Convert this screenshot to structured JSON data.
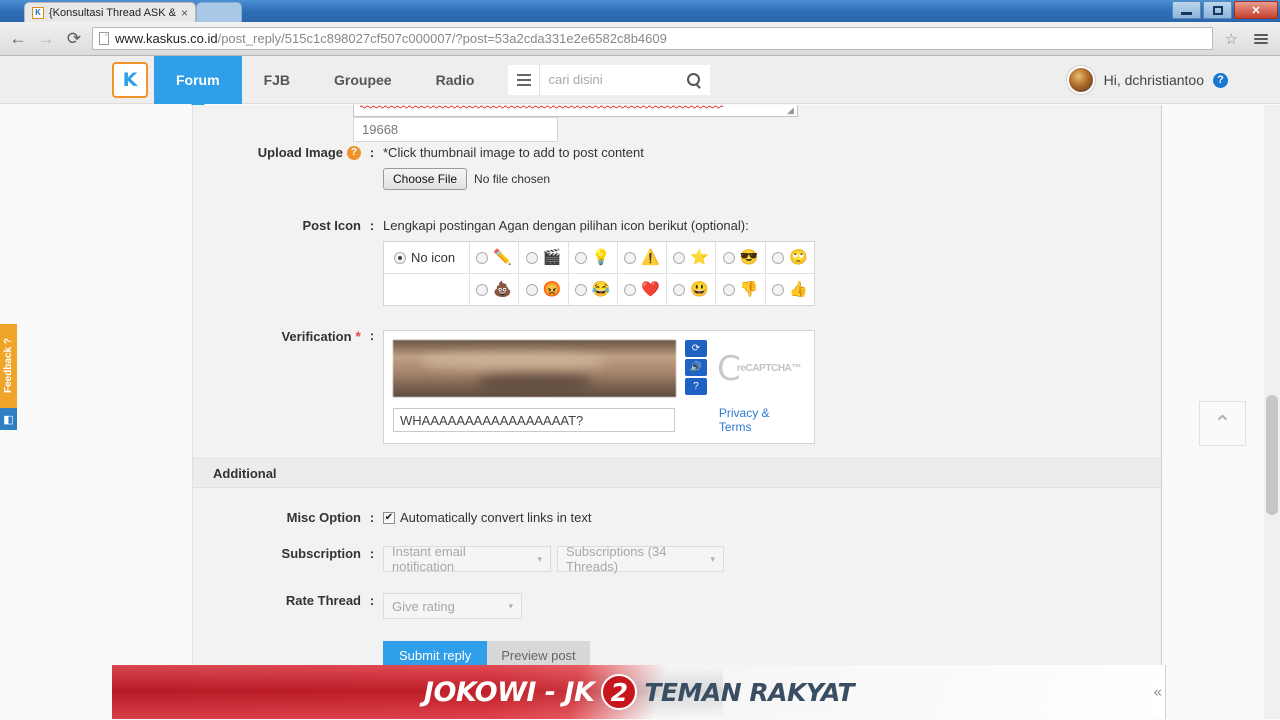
{
  "browser": {
    "tab": {
      "title": "{Konsultasi Thread ASK &",
      "favicon_icon": "kaskus-favicon",
      "close_icon": "close-icon"
    },
    "new_tab_icon": "new-tab-icon",
    "window_controls": {
      "minimize": "minimize-icon",
      "restore": "restore-icon",
      "close": "✕"
    },
    "back_icon": "←",
    "forward_icon": "→",
    "reload_icon": "⟳",
    "url_domain": "www.kaskus.co.id",
    "url_path": "/post_reply/515c1c898027cf507c000007/?post=53a2cda331e2e6582c8b4609",
    "page_icon": "page-icon",
    "bookmark_icon": "☆",
    "menu_icon": "hamburger-menu-icon"
  },
  "site_header": {
    "logo": "K",
    "nav": [
      {
        "label": "Forum",
        "active": true
      },
      {
        "label": "FJB",
        "active": false
      },
      {
        "label": "Groupee",
        "active": false
      },
      {
        "label": "Radio",
        "active": false
      }
    ],
    "search_placeholder": "cari disini",
    "search_icon": "search-icon",
    "menu_icon": "grid-menu-icon",
    "user_greeting": "Hi, dchristiantoo",
    "help_badge": "?",
    "avatar": "user-avatar"
  },
  "form": {
    "char_counter": "19668",
    "upload_image": {
      "label": "Upload Image",
      "help_icon": "?",
      "colon": ":",
      "hint": "*Click thumbnail image to add to post content",
      "choose_file_button": "Choose File",
      "no_file_text": "No file chosen"
    },
    "post_icon": {
      "label": "Post Icon",
      "colon": ":",
      "hint": "Lengkapi postingan Agan dengan pilihan icon berikut (optional):",
      "no_icon_label": "No icon",
      "row1": [
        {
          "name": "pencil-icon",
          "glyph": "✏️"
        },
        {
          "name": "clapperboard-icon",
          "glyph": "🎬"
        },
        {
          "name": "lightbulb-icon",
          "glyph": "💡"
        },
        {
          "name": "warning-icon",
          "glyph": "⚠️"
        },
        {
          "name": "star-icon",
          "glyph": "⭐"
        },
        {
          "name": "cool-face-icon",
          "glyph": "😎"
        },
        {
          "name": "rolling-eyes-icon",
          "glyph": "🙄"
        }
      ],
      "row2": [
        {
          "name": "poop-icon",
          "glyph": "💩"
        },
        {
          "name": "angry-red-face-icon",
          "glyph": "😡"
        },
        {
          "name": "laughing-face-icon",
          "glyph": "😂"
        },
        {
          "name": "heart-icon",
          "glyph": "❤️"
        },
        {
          "name": "blue-smile-face-icon",
          "glyph": "😃"
        },
        {
          "name": "thumbs-down-icon",
          "glyph": "👎"
        },
        {
          "name": "thumbs-up-icon",
          "glyph": "👍"
        }
      ]
    },
    "verification": {
      "label": "Verification",
      "required_mark": "*",
      "colon": ":",
      "input_value": "WHAAAAAAAAAAAAAAAAAT?",
      "refresh_icon": "⟳",
      "audio_icon": "🔊",
      "help_icon": "?",
      "recaptcha_brand_c": "C",
      "recaptcha_brand_text": "reCAPTCHA™",
      "privacy_terms": "Privacy & Terms",
      "captcha_image": "captcha-image"
    },
    "additional": {
      "section_title": "Additional",
      "misc_option": {
        "label": "Misc Option",
        "colon": ":",
        "checkbox_checked": true,
        "checkbox_label": "Automatically convert links in text"
      },
      "subscription": {
        "label": "Subscription",
        "colon": ":",
        "select_value": "Instant email notification",
        "button_value": "Subscriptions (34 Threads)",
        "caret": "▾"
      },
      "rate_thread": {
        "label": "Rate Thread",
        "colon": ":",
        "select_value": "Give rating",
        "caret": "▾"
      }
    },
    "buttons": {
      "submit": "Submit reply",
      "preview": "Preview post"
    }
  },
  "feedback_tab": {
    "label": "Feedback ?",
    "icon": "feedback-widget-icon"
  },
  "scroll_top": {
    "icon": "chevron-up-icon",
    "glyph": "⌃"
  },
  "ad": {
    "headline": "JOKOWI - JK",
    "number": "2",
    "tagline": "TEMAN RAKYAT",
    "collapse_icon": "«"
  }
}
